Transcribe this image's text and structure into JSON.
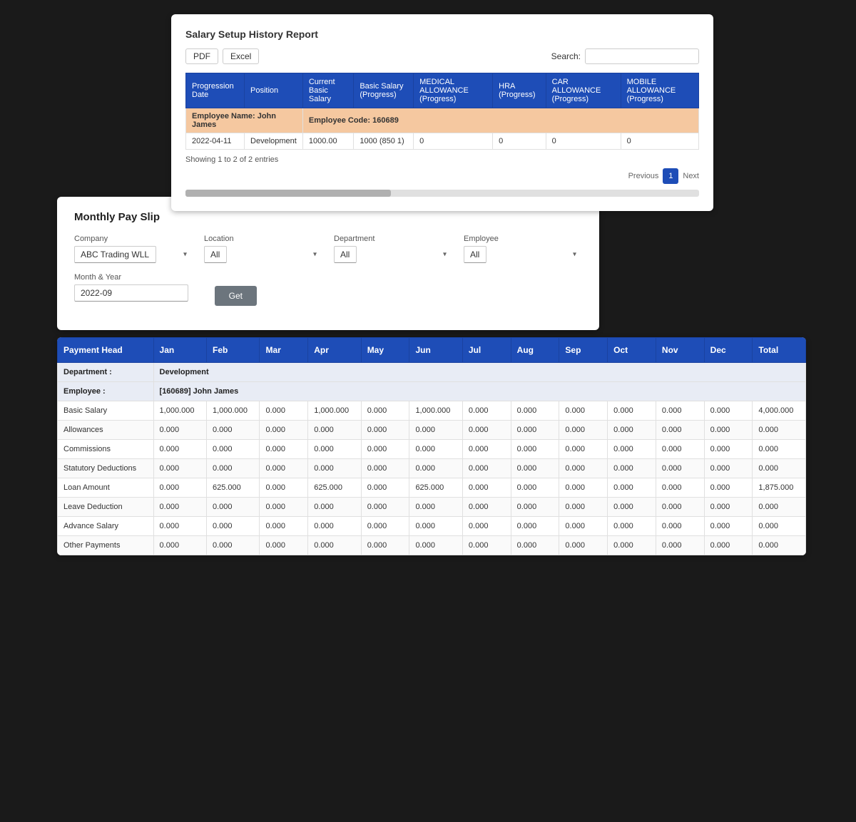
{
  "salaryReport": {
    "title": "Salary Setup History Report",
    "buttons": {
      "pdf": "PDF",
      "excel": "Excel"
    },
    "search": {
      "label": "Search:",
      "value": ""
    },
    "tableHeaders": [
      "Progression Date",
      "Position",
      "Current Basic Salary",
      "Basic Salary (Progress)",
      "MEDICAL ALLOWANCE (Progress)",
      "HRA (Progress)",
      "CAR ALLOWANCE (Progress)",
      "MOBILE ALLOWANCE (Progress)"
    ],
    "employeeRow": {
      "name": "Employee Name: John James",
      "code": "Employee Code: 160689"
    },
    "dataRow": {
      "date": "2022-04-11",
      "position": "Development",
      "currentBasic": "1000.00",
      "basicProgress": "1000 (850 1)",
      "medical": "0",
      "hra": "0",
      "car": "0",
      "mobile": "0"
    },
    "showing": "Showing 1 to 2 of 2 entries",
    "pagination": {
      "prev": "Previous",
      "next": "Next",
      "current": "1"
    }
  },
  "monthlyPaySlip": {
    "title": "Monthly Pay Slip",
    "fields": {
      "company": {
        "label": "Company",
        "value": "ABC Trading WLL"
      },
      "location": {
        "label": "Location",
        "value": "All"
      },
      "department": {
        "label": "Department",
        "value": "All"
      },
      "employee": {
        "label": "Employee",
        "value": "All"
      },
      "monthYear": {
        "label": "Month & Year",
        "value": "2022-09"
      }
    },
    "getButton": "Get"
  },
  "paymentTable": {
    "headers": [
      "Payment Head",
      "Jan",
      "Feb",
      "Mar",
      "Apr",
      "May",
      "Jun",
      "Jul",
      "Aug",
      "Sep",
      "Oct",
      "Nov",
      "Dec",
      "Total"
    ],
    "department": {
      "label": "Department :",
      "value": "Development"
    },
    "employee": {
      "label": "Employee :",
      "value": "[160689] John James"
    },
    "rows": [
      {
        "head": "Basic Salary",
        "jan": "1,000.000",
        "feb": "1,000.000",
        "mar": "0.000",
        "apr": "1,000.000",
        "may": "0.000",
        "jun": "1,000.000",
        "jul": "0.000",
        "aug": "0.000",
        "sep": "0.000",
        "oct": "0.000",
        "nov": "0.000",
        "dec": "0.000",
        "total": "4,000.000"
      },
      {
        "head": "Allowances",
        "jan": "0.000",
        "feb": "0.000",
        "mar": "0.000",
        "apr": "0.000",
        "may": "0.000",
        "jun": "0.000",
        "jul": "0.000",
        "aug": "0.000",
        "sep": "0.000",
        "oct": "0.000",
        "nov": "0.000",
        "dec": "0.000",
        "total": "0.000"
      },
      {
        "head": "Commissions",
        "jan": "0.000",
        "feb": "0.000",
        "mar": "0.000",
        "apr": "0.000",
        "may": "0.000",
        "jun": "0.000",
        "jul": "0.000",
        "aug": "0.000",
        "sep": "0.000",
        "oct": "0.000",
        "nov": "0.000",
        "dec": "0.000",
        "total": "0.000"
      },
      {
        "head": "Statutory Deductions",
        "jan": "0.000",
        "feb": "0.000",
        "mar": "0.000",
        "apr": "0.000",
        "may": "0.000",
        "jun": "0.000",
        "jul": "0.000",
        "aug": "0.000",
        "sep": "0.000",
        "oct": "0.000",
        "nov": "0.000",
        "dec": "0.000",
        "total": "0.000"
      },
      {
        "head": "Loan Amount",
        "jan": "0.000",
        "feb": "625.000",
        "mar": "0.000",
        "apr": "625.000",
        "may": "0.000",
        "jun": "625.000",
        "jul": "0.000",
        "aug": "0.000",
        "sep": "0.000",
        "oct": "0.000",
        "nov": "0.000",
        "dec": "0.000",
        "total": "1,875.000"
      },
      {
        "head": "Leave Deduction",
        "jan": "0.000",
        "feb": "0.000",
        "mar": "0.000",
        "apr": "0.000",
        "may": "0.000",
        "jun": "0.000",
        "jul": "0.000",
        "aug": "0.000",
        "sep": "0.000",
        "oct": "0.000",
        "nov": "0.000",
        "dec": "0.000",
        "total": "0.000"
      },
      {
        "head": "Advance Salary",
        "jan": "0.000",
        "feb": "0.000",
        "mar": "0.000",
        "apr": "0.000",
        "may": "0.000",
        "jun": "0.000",
        "jul": "0.000",
        "aug": "0.000",
        "sep": "0.000",
        "oct": "0.000",
        "nov": "0.000",
        "dec": "0.000",
        "total": "0.000"
      },
      {
        "head": "Other Payments",
        "jan": "0.000",
        "feb": "0.000",
        "mar": "0.000",
        "apr": "0.000",
        "may": "0.000",
        "jun": "0.000",
        "jul": "0.000",
        "aug": "0.000",
        "sep": "0.000",
        "oct": "0.000",
        "nov": "0.000",
        "dec": "0.000",
        "total": "0.000"
      }
    ]
  }
}
